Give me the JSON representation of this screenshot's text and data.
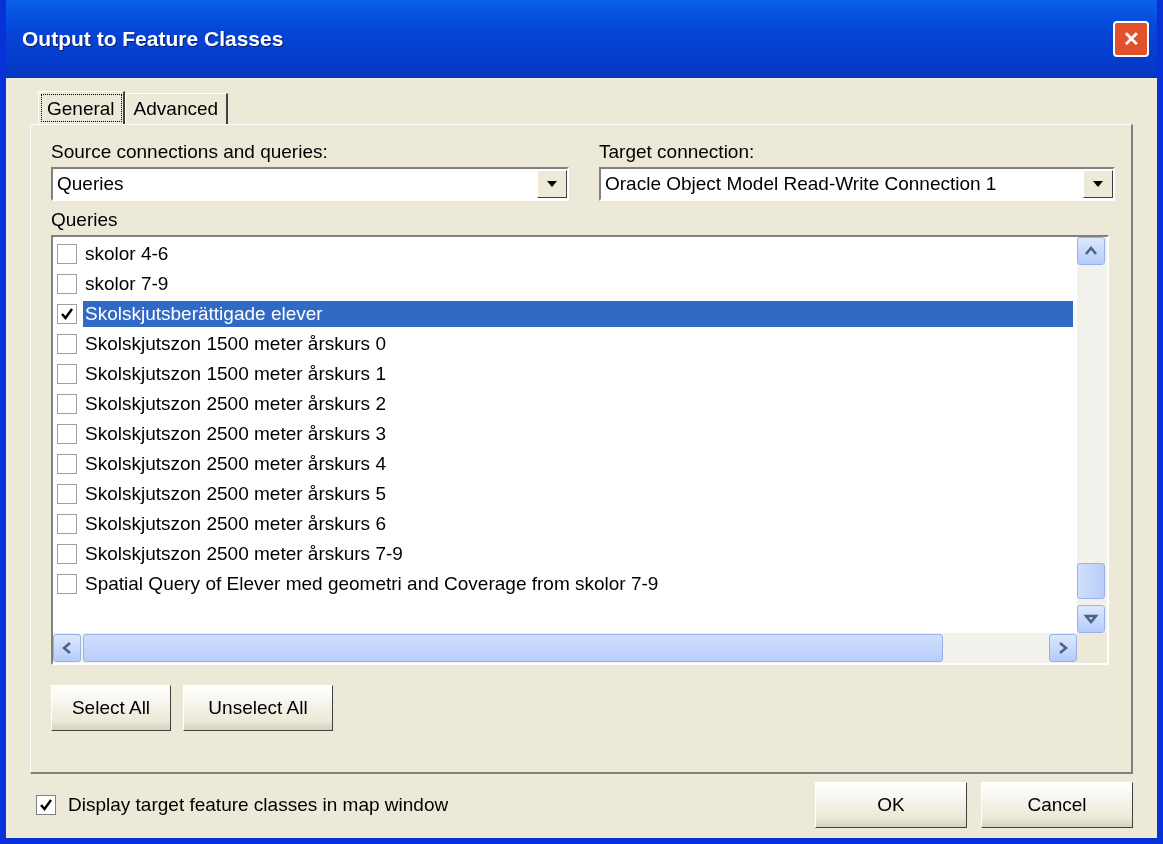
{
  "window": {
    "title": "Output to Feature Classes",
    "close": "✕"
  },
  "tabs": [
    {
      "label": "General",
      "selected": true
    },
    {
      "label": "Advanced",
      "selected": false
    }
  ],
  "source": {
    "label": "Source connections and queries:",
    "value": "Queries"
  },
  "target": {
    "label": "Target connection:",
    "value": "Oracle Object Model Read-Write Connection 1"
  },
  "queries": {
    "label": "Queries",
    "items": [
      {
        "label": "skolor 4-6",
        "checked": false,
        "selected": false
      },
      {
        "label": "skolor 7-9",
        "checked": false,
        "selected": false
      },
      {
        "label": "Skolskjutsberättigade elever",
        "checked": true,
        "selected": true
      },
      {
        "label": "Skolskjutszon 1500 meter årskurs 0",
        "checked": false,
        "selected": false
      },
      {
        "label": "Skolskjutszon 1500 meter årskurs 1",
        "checked": false,
        "selected": false
      },
      {
        "label": "Skolskjutszon 2500 meter årskurs 2",
        "checked": false,
        "selected": false
      },
      {
        "label": "Skolskjutszon 2500 meter årskurs 3",
        "checked": false,
        "selected": false
      },
      {
        "label": "Skolskjutszon 2500 meter årskurs 4",
        "checked": false,
        "selected": false
      },
      {
        "label": "Skolskjutszon 2500 meter årskurs 5",
        "checked": false,
        "selected": false
      },
      {
        "label": "Skolskjutszon 2500 meter årskurs 6",
        "checked": false,
        "selected": false
      },
      {
        "label": "Skolskjutszon 2500 meter årskurs 7-9",
        "checked": false,
        "selected": false
      },
      {
        "label": "Spatial Query of Elever med geometri and Coverage from skolor 7-9",
        "checked": false,
        "selected": false
      }
    ]
  },
  "list_buttons": [
    "Select All",
    "Unselect All"
  ],
  "display_option": {
    "label": "Display target feature classes in map window",
    "checked": true
  },
  "buttons": [
    "OK",
    "Cancel"
  ]
}
